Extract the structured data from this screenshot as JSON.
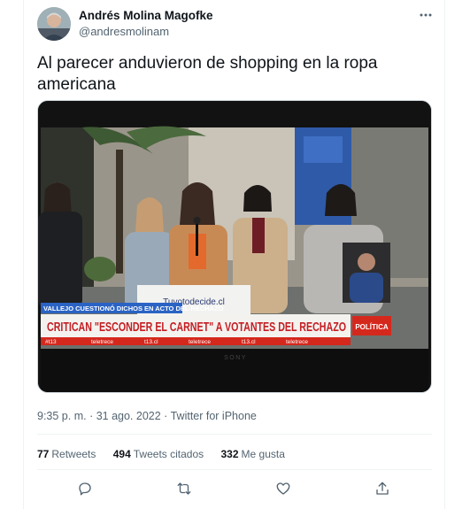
{
  "author": {
    "name": "Andrés Molina Magofke",
    "handle": "@andresmolinam"
  },
  "tweet": {
    "text": "Al parecer anduvieron de shopping en la ropa americana"
  },
  "media": {
    "caption_banner": "VALLEJO CUESTIONÓ DICHOS EN ACTO DEL RECHAZO",
    "headline": "CRITICAN \"ESCONDER EL CARNET\" A VOTANTES DEL RECHAZO",
    "badge": "POLÍTICA",
    "podium_sign": "Tuvotodecide.cl",
    "ticker_items": [
      "#t13",
      "teletrece",
      "t13.cl",
      "teletrece",
      "t13.cl",
      "teletrece"
    ],
    "tv_brand": "SONY"
  },
  "meta": {
    "time": "9:35 p. m.",
    "separator1": " · ",
    "date": "31 ago. 2022",
    "separator2": " · ",
    "source": "Twitter for iPhone"
  },
  "stats": {
    "retweets_count": "77",
    "retweets_label": "Retweets",
    "quotes_count": "494",
    "quotes_label": "Tweets citados",
    "likes_count": "332",
    "likes_label": "Me gusta"
  },
  "icons": {
    "more": "more-icon",
    "reply": "reply-icon",
    "retweet": "retweet-icon",
    "like": "like-icon",
    "share": "share-icon"
  },
  "colors": {
    "text_primary": "#0f1419",
    "text_secondary": "#536471",
    "divider": "#eff3f4",
    "tv_red": "#d5281d",
    "tv_blue": "#2a63c4"
  }
}
